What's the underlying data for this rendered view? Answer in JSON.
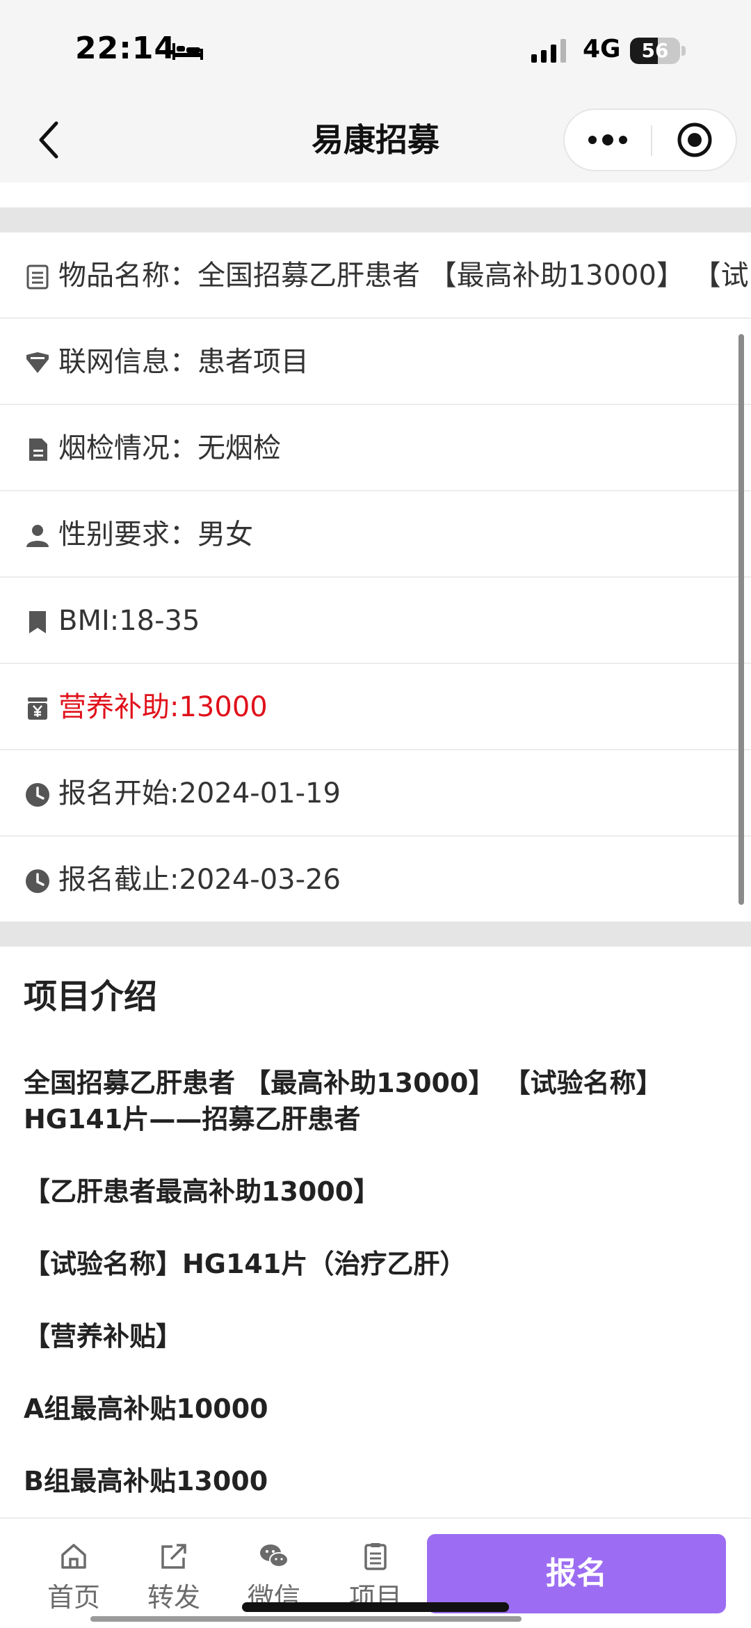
{
  "status_bar": {
    "time": "22:14",
    "network": "4G",
    "battery": "56",
    "battery_level": 0.56
  },
  "nav": {
    "title": "易康招募",
    "back_icon": "chevron-left-icon",
    "more_icon": "more-dots-icon",
    "close_icon": "target-circle-icon"
  },
  "info": [
    {
      "icon": "list-icon",
      "text": "物品名称：全国招募乙肝患者 【最高补助13000】 【试"
    },
    {
      "icon": "shield-icon",
      "text": "联网信息：患者项目"
    },
    {
      "icon": "document-icon",
      "text": "烟检情况：无烟检"
    },
    {
      "icon": "person-icon",
      "text": "性别要求：男女"
    },
    {
      "icon": "bookmark-icon",
      "text": "BMI:18-35"
    },
    {
      "icon": "yen-jar-icon",
      "text": "营养补助:13000",
      "highlight": true,
      "color": "#e0111b"
    },
    {
      "icon": "clock-icon",
      "text": "报名开始:2024-01-19"
    },
    {
      "icon": "clock-icon",
      "text": "报名截止:2024-03-26"
    }
  ],
  "intro": {
    "title": "项目介绍",
    "paragraphs": [
      "全国招募乙肝患者 【最高补助13000】 【试验名称】HG141片——招募乙肝患者",
      "【乙肝患者最高补助13000】",
      "【试验名称】HG141片（治疗乙肝）",
      "【营养补贴】",
      "A组最高补贴10000",
      "B组最高补贴13000"
    ]
  },
  "bottom_bar": {
    "tabs": [
      {
        "label": "首页",
        "icon": "home-icon"
      },
      {
        "label": "转发",
        "icon": "share-icon"
      },
      {
        "label": "微信",
        "icon": "wechat-icon"
      },
      {
        "label": "项目",
        "icon": "clipboard-icon"
      }
    ],
    "signup_label": "报名",
    "accent": "#9c6df2"
  }
}
